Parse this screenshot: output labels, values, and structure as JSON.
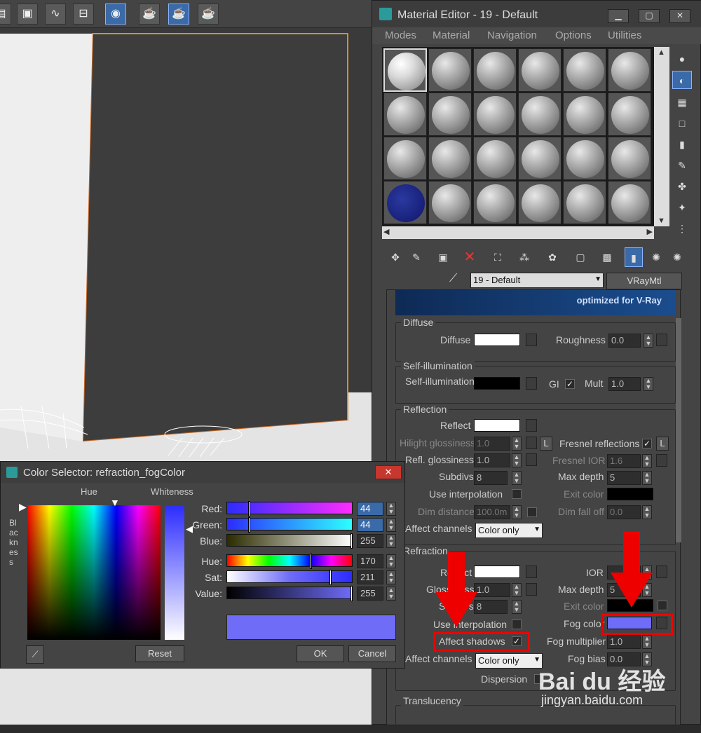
{
  "material_editor": {
    "title": "Material Editor - 19 - Default",
    "menu": [
      "Modes",
      "Material",
      "Navigation",
      "Options",
      "Utilities"
    ],
    "material_name": "19 - Default",
    "material_type": "VRayMtl",
    "banner_text": "optimized for V-Ray",
    "diffuse": {
      "group": "Diffuse",
      "diffuse_label": "Diffuse",
      "roughness_label": "Roughness",
      "roughness_value": "0.0"
    },
    "self_illum": {
      "group": "Self-illumination",
      "label": "Self-illumination",
      "gi_label": "GI",
      "mult_label": "Mult",
      "mult_value": "1.0"
    },
    "reflection": {
      "group": "Reflection",
      "reflect_label": "Reflect",
      "hilight_label": "Hilight glossiness",
      "hilight_value": "1.0",
      "l_label": "L",
      "fresnel_label": "Fresnel reflections",
      "fresnel_l_label": "L",
      "refl_gloss_label": "Refl. glossiness",
      "refl_gloss_value": "1.0",
      "fresnel_ior_label": "Fresnel IOR",
      "fresnel_ior_value": "1.6",
      "subdivs_label": "Subdivs",
      "subdivs_value": "8",
      "max_depth_label": "Max depth",
      "max_depth_value": "5",
      "use_interp_label": "Use interpolation",
      "exit_color_label": "Exit color",
      "dim_distance_label": "Dim distance",
      "dim_distance_value": "100.0m",
      "dim_falloff_label": "Dim fall off",
      "dim_falloff_value": "0.0",
      "affect_channels_label": "Affect channels",
      "affect_channels_value": "Color only"
    },
    "refraction": {
      "group": "Refraction",
      "refract_label": "Refract",
      "ior_label": "IOR",
      "glossiness_label": "Glossiness",
      "glossiness_value": "1.0",
      "max_depth_label": "Max depth",
      "max_depth_value": "5",
      "subdivs_label": "Subdivs",
      "subdivs_value": "8",
      "exit_color_label": "Exit color",
      "use_interp_label": "Use interpolation",
      "fog_color_label": "Fog color",
      "affect_shadows_label": "Affect shadows",
      "fog_mult_label": "Fog multiplier",
      "fog_mult_value": "1.0",
      "affect_channels_label": "Affect channels",
      "affect_channels_value": "Color only",
      "fog_bias_label": "Fog bias",
      "fog_bias_value": "0.0",
      "dispersion_label": "Dispersion"
    },
    "translucency_group": "Translucency"
  },
  "color_selector": {
    "title": "Color Selector: refraction_fogColor",
    "hue_label": "Hue",
    "whiteness_label": "Whiteness",
    "blackness_label": "Blackness",
    "channels": [
      {
        "label": "Red:",
        "value": "44",
        "fraction": 0.17
      },
      {
        "label": "Green:",
        "value": "44",
        "fraction": 0.17
      },
      {
        "label": "Blue:",
        "value": "255",
        "fraction": 1.0
      },
      {
        "label": "Hue:",
        "value": "170",
        "fraction": 0.67
      },
      {
        "label": "Sat:",
        "value": "211",
        "fraction": 0.83
      },
      {
        "label": "Value:",
        "value": "255",
        "fraction": 1.0
      }
    ],
    "reset_label": "Reset",
    "ok_label": "OK",
    "cancel_label": "Cancel"
  },
  "colors": {
    "fog_color": "#6f6cf8",
    "selected_blue": "#3a6aa8",
    "highlight_red": "#e00000"
  },
  "watermark": {
    "brand": "Bai du 经验",
    "url": "jingyan.baidu.com"
  }
}
